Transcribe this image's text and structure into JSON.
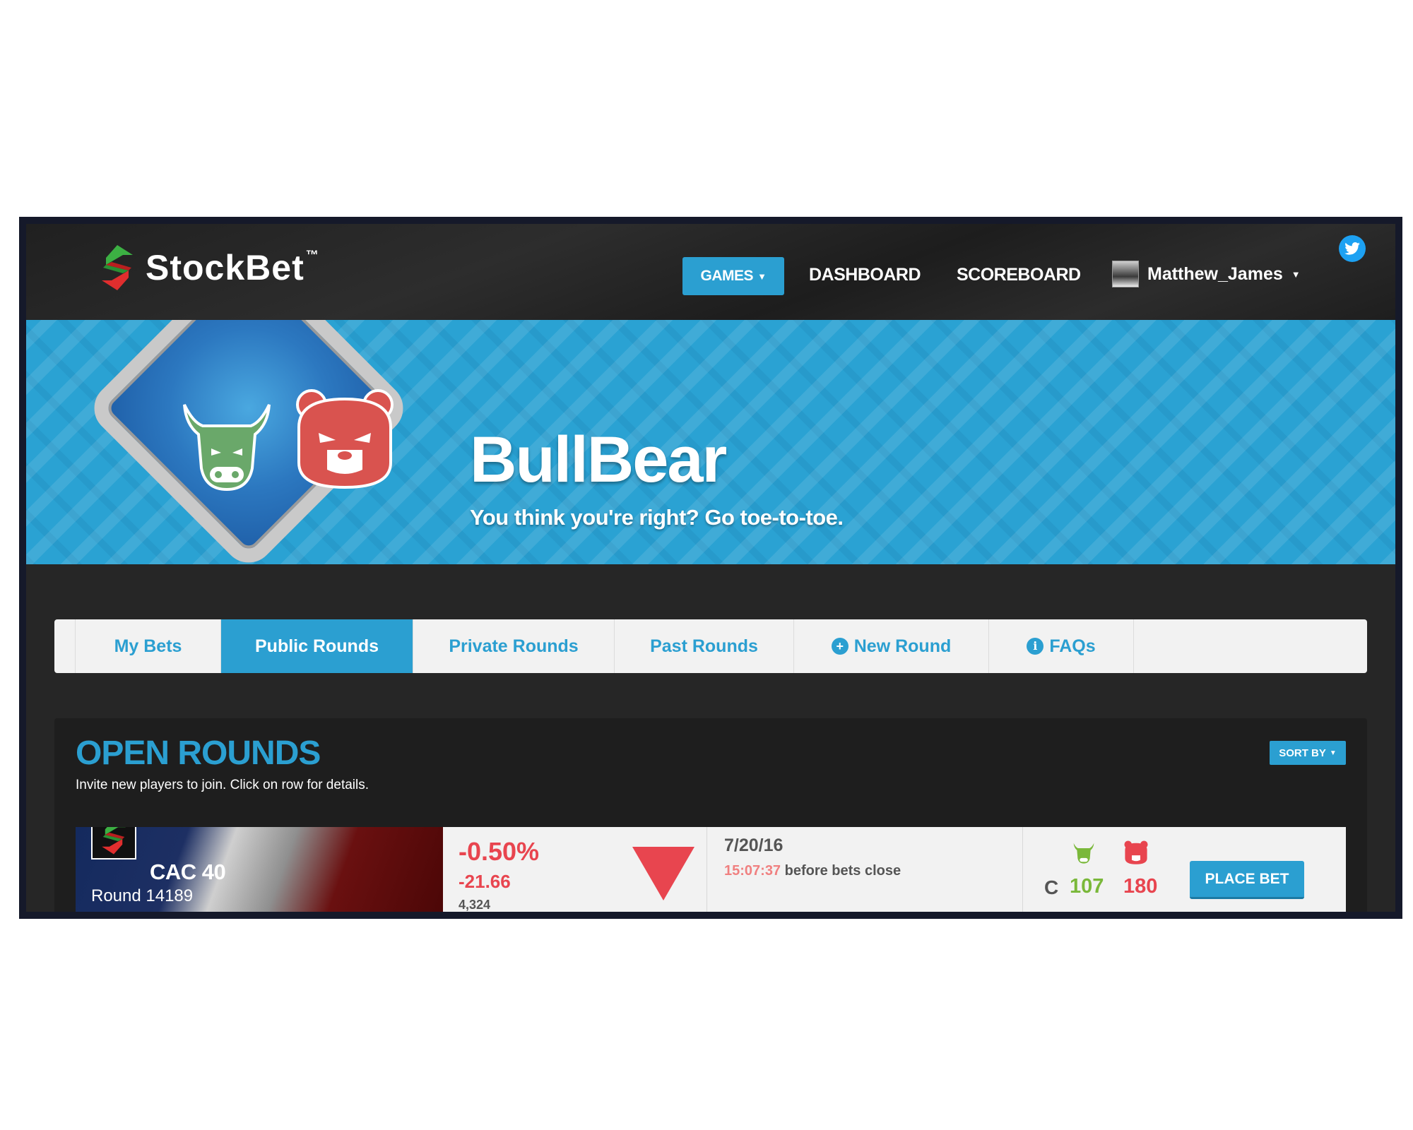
{
  "brand": {
    "name": "StockBet",
    "trademark": "™"
  },
  "nav": {
    "games_label": "GAMES",
    "dashboard_label": "DASHBOARD",
    "scoreboard_label": "SCOREBOARD",
    "username": "Matthew_James"
  },
  "hero": {
    "title": "BullBear",
    "subtitle": "You think you're right? Go toe-to-toe."
  },
  "tabs": [
    {
      "label": "My Bets",
      "active": false
    },
    {
      "label": "Public Rounds",
      "active": true
    },
    {
      "label": "Private Rounds",
      "active": false
    },
    {
      "label": "Past Rounds",
      "active": false
    },
    {
      "label": "New Round",
      "icon": "plus-circle-icon",
      "active": false
    },
    {
      "label": "FAQs",
      "icon": "info-circle-icon",
      "active": false
    }
  ],
  "open_rounds": {
    "title": "OPEN ROUNDS",
    "description": "Invite new players to join. Click on row for details.",
    "sort_label": "SORT BY",
    "rounds": [
      {
        "index_name": "CAC 40",
        "round_label": "Round 14189",
        "pct_change": "-0.50%",
        "pts_change": "-21.66",
        "index_value": "4,324",
        "direction": "down",
        "close_date": "7/20/16",
        "countdown": "15:07:37",
        "countdown_suffix": " before bets close",
        "currency": "C",
        "bull_count": "107",
        "bear_count": "180",
        "place_bet_label": "PLACE BET"
      }
    ]
  },
  "colors": {
    "accent": "#2b9fd1",
    "negative": "#e8454f",
    "bull": "#7ab83a",
    "bear": "#e8454f",
    "header_bg": "#262626"
  }
}
